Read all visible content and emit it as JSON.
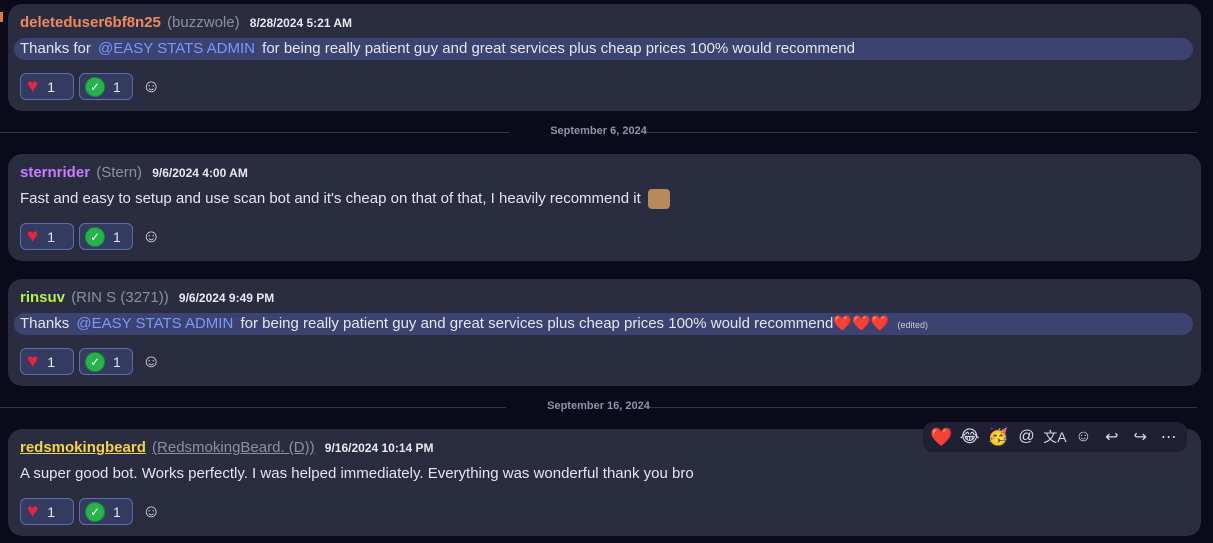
{
  "messages": [
    {
      "author": "deleteduser6bf8n25",
      "nick": "(buzzwole)",
      "timestamp": "8/28/2024 5:21 AM",
      "text_before": "Thanks for",
      "mention": "@EASY STATS ADMIN",
      "text_after": "for being really patient guy and great services plus cheap prices 100% would recommend",
      "reactions": [
        {
          "icon": "heart",
          "count": "1"
        },
        {
          "icon": "check",
          "count": "1"
        }
      ]
    },
    {
      "author": "sternrider",
      "nick": "(Stern)",
      "timestamp": "9/6/2024 4:00 AM",
      "text": "Fast and easy to setup and use scan bot and it's cheap on that of that, I heavily recommend it",
      "reactions": [
        {
          "icon": "heart",
          "count": "1"
        },
        {
          "icon": "check",
          "count": "1"
        }
      ]
    },
    {
      "author": "rinsuv",
      "nick": "(RIN S (3271))",
      "timestamp": "9/6/2024 9:49 PM",
      "text_before": "Thanks",
      "mention": "@EASY STATS ADMIN",
      "text_after": "for being really patient guy and great services plus cheap prices 100% would recommend",
      "trailing_emoji": "❤️❤️❤️",
      "edited": "(edited)",
      "reactions": [
        {
          "icon": "heart",
          "count": "1"
        },
        {
          "icon": "check",
          "count": "1"
        }
      ]
    },
    {
      "author": "redsmokingbeard",
      "nick": "(RedsmokingBeard. (D))",
      "timestamp": "9/16/2024 10:14 PM",
      "text": "A super good bot. Works perfectly. I was helped immediately. Everything was  wonderful   thank you bro",
      "reactions": [
        {
          "icon": "heart",
          "count": "1"
        },
        {
          "icon": "check",
          "count": "1"
        }
      ]
    }
  ],
  "dividers": [
    "September 6, 2024",
    "September 16, 2024"
  ],
  "toolbar": {
    "quick_reactions": [
      "❤️",
      "😂",
      "🥳"
    ],
    "actions": [
      "mention-icon",
      "translate-icon",
      "add-reaction-icon",
      "reply-icon",
      "forward-icon",
      "more-icon"
    ]
  },
  "colors": {
    "background": "#0b0a1a",
    "card": "#2a2c3f",
    "highlight": "#3c4370",
    "mention": "#7c97ff",
    "author_1": "#f08a5d",
    "author_2": "#c77dff",
    "author_3": "#b6f04a",
    "author_4": "#f5d442"
  }
}
